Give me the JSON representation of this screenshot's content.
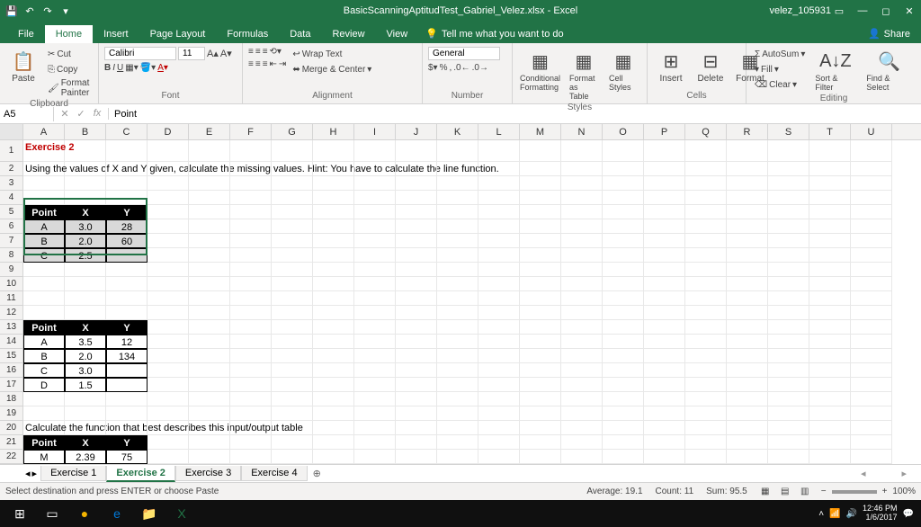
{
  "titlebar": {
    "title": "BasicScanningAptitudTest_Gabriel_Velez.xlsx - Excel",
    "user": "velez_105931"
  },
  "tabs": [
    "File",
    "Home",
    "Insert",
    "Page Layout",
    "Formulas",
    "Data",
    "Review",
    "View"
  ],
  "activeTab": "Home",
  "tell": "Tell me what you want to do",
  "share": "Share",
  "ribbon": {
    "clipboard": {
      "label": "Clipboard",
      "paste": "Paste",
      "cut": "Cut",
      "copy": "Copy",
      "painter": "Format Painter"
    },
    "font": {
      "label": "Font",
      "name": "Calibri",
      "size": "11"
    },
    "alignment": {
      "label": "Alignment",
      "wrap": "Wrap Text",
      "merge": "Merge & Center"
    },
    "number": {
      "label": "Number",
      "format": "General"
    },
    "styles": {
      "label": "Styles",
      "cond": "Conditional Formatting",
      "table": "Format as Table",
      "cell": "Cell Styles"
    },
    "cells": {
      "label": "Cells",
      "insert": "Insert",
      "delete": "Delete",
      "format": "Format"
    },
    "editing": {
      "label": "Editing",
      "autosum": "AutoSum",
      "fill": "Fill",
      "clear": "Clear",
      "sort": "Sort & Filter",
      "find": "Find & Select"
    }
  },
  "namebox": "A5",
  "formula": "Point",
  "cols": [
    "A",
    "B",
    "C",
    "D",
    "E",
    "F",
    "G",
    "H",
    "I",
    "J",
    "K",
    "L",
    "M",
    "N",
    "O",
    "P",
    "Q",
    "R",
    "S",
    "T",
    "U"
  ],
  "sheet": {
    "r1_a": "Exercise 2",
    "r2_a": "Using the values of X and Y given, calculate the missing values.  Hint: You have to calculate the line function.",
    "t1": {
      "h": [
        "Point",
        "X",
        "Y"
      ],
      "rows": [
        [
          "A",
          "3.0",
          "28"
        ],
        [
          "B",
          "2.0",
          "60"
        ],
        [
          "C",
          "2.5",
          ""
        ]
      ]
    },
    "t2": {
      "h": [
        "Point",
        "X",
        "Y"
      ],
      "rows": [
        [
          "A",
          "3.5",
          "12"
        ],
        [
          "B",
          "2.0",
          "134"
        ],
        [
          "C",
          "3.0",
          ""
        ],
        [
          "D",
          "1.5",
          ""
        ]
      ]
    },
    "r20_a": "Calculate the function that best describes this input/output table",
    "t3": {
      "h": [
        "Point",
        "X",
        "Y"
      ],
      "rows": [
        [
          "M",
          "2.39",
          "75"
        ]
      ]
    }
  },
  "sheets": [
    "Exercise 1",
    "Exercise 2",
    "Exercise 3",
    "Exercise 4"
  ],
  "activeSheet": "Exercise 2",
  "status": {
    "msg": "Select destination and press ENTER or choose Paste",
    "avg": "Average: 19.1",
    "count": "Count: 11",
    "sum": "Sum: 95.5",
    "zoom": "100%"
  },
  "clock": {
    "time": "12:46 PM",
    "date": "1/6/2017"
  }
}
